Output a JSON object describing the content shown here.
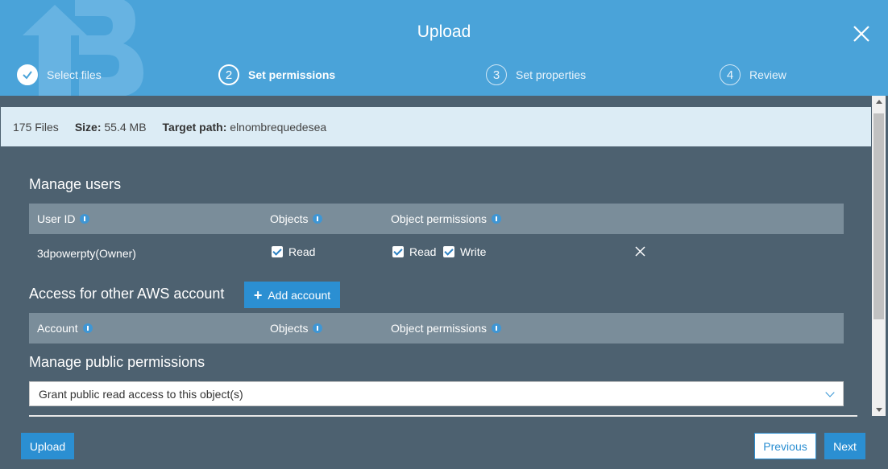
{
  "header": {
    "title": "Upload",
    "steps": [
      {
        "num": "",
        "label": "Select files"
      },
      {
        "num": "2",
        "label": "Set permissions"
      },
      {
        "num": "3",
        "label": "Set properties"
      },
      {
        "num": "4",
        "label": "Review"
      }
    ]
  },
  "info": {
    "files": "175 Files",
    "size_label": "Size:",
    "size_value": "55.4 MB",
    "path_label": "Target path:",
    "path_value": "elnombrequedesea"
  },
  "manage_users": {
    "title": "Manage users",
    "columns": [
      "User ID",
      "Objects",
      "Object permissions"
    ],
    "row": {
      "user_id": "3dpowerpty(Owner)",
      "objects_read": "Read",
      "perm_read": "Read",
      "perm_write": "Write"
    }
  },
  "aws_account": {
    "title": "Access for other AWS account",
    "add_button": "Add account",
    "columns": [
      "Account",
      "Objects",
      "Object permissions"
    ]
  },
  "public": {
    "title": "Manage public permissions",
    "selected": "Grant public read access to this object(s)"
  },
  "footer": {
    "upload": "Upload",
    "previous": "Previous",
    "next": "Next"
  },
  "colors": {
    "header_bg": "#4aa3d9",
    "body_bg": "#4d6170",
    "accent": "#2b8fd2"
  }
}
